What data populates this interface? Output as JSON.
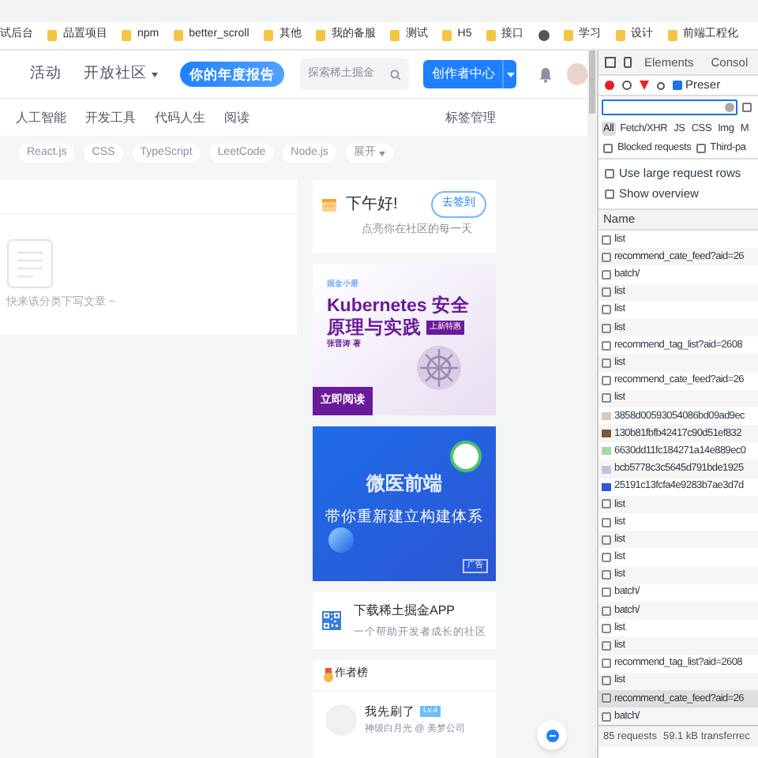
{
  "bookmarks": [
    {
      "kind": "text",
      "label": "试后台"
    },
    {
      "kind": "folder",
      "label": "品置项目"
    },
    {
      "kind": "folder",
      "label": "npm"
    },
    {
      "kind": "folder",
      "label": "better_scroll"
    },
    {
      "kind": "folder",
      "label": "其他"
    },
    {
      "kind": "folder",
      "label": "我的备服"
    },
    {
      "kind": "folder",
      "label": "测试"
    },
    {
      "kind": "folder",
      "label": "H5"
    },
    {
      "kind": "folder",
      "label": "接口"
    },
    {
      "kind": "globe"
    },
    {
      "kind": "folder",
      "label": "学习"
    },
    {
      "kind": "folder",
      "label": "设计"
    },
    {
      "kind": "folder",
      "label": "前端工程化"
    }
  ],
  "header": {
    "nav": [
      {
        "label": "活动",
        "dropdown": false
      },
      {
        "label": "开放社区",
        "dropdown": true
      }
    ],
    "year_report": "你的年度报告",
    "search": {
      "placeholder": "探索稀土掘金"
    },
    "creator_button": "创作者中心"
  },
  "categories": [
    "人工智能",
    "开发工具",
    "代码人生",
    "阅读"
  ],
  "tag_manage": "标签管理",
  "tags": [
    "React.js",
    "CSS",
    "TypeScript",
    "LeetCode",
    "Node.js"
  ],
  "expand": "展开",
  "empty_feed": {
    "message": "快来该分类下写文章 ~"
  },
  "sign_in": {
    "greeting": "下午好!",
    "button": "去签到",
    "subtitle": "点亮你在社区的每一天"
  },
  "ad_book": {
    "brand": "掘金小册",
    "title_1": "Kubernetes 安全",
    "title_2": "原理与实践",
    "badge": "上新特惠",
    "author": "张晋涛 著",
    "button": "立即阅读"
  },
  "ad_banner": {
    "title": "微医前端",
    "subtitle": "带你重新建立构建体系",
    "tag": "广告"
  },
  "app_card": {
    "title": "下载稀土掘金APP",
    "subtitle": "一个帮助开发者成长的社区"
  },
  "author_list": {
    "title": "作者榜",
    "authors": [
      {
        "name": "我先刷了",
        "level": "Lv.4",
        "description": "神级白月光 @ 美梦公司"
      }
    ]
  },
  "devtools": {
    "tabs": [
      {
        "label": "Elements",
        "selected": false
      },
      {
        "label": "Consol",
        "selected": false
      }
    ],
    "preserve_log": {
      "label": "Preser",
      "checked": true
    },
    "filters": [
      {
        "label": "All",
        "selected": true
      },
      {
        "label": "Fetch/XHR",
        "selected": false
      },
      {
        "label": "JS",
        "selected": false
      },
      {
        "label": "CSS",
        "selected": false
      },
      {
        "label": "Img",
        "selected": false
      },
      {
        "label": "M",
        "selected": false
      }
    ],
    "options": [
      {
        "label": "Blocked requests",
        "checked": false
      },
      {
        "label": "Third-pa",
        "checked": false
      }
    ],
    "more_options": [
      {
        "label": "Use large request rows",
        "checked": false
      },
      {
        "label": "Show overview",
        "checked": false
      }
    ],
    "filter_checkbox": {
      "checked": false
    },
    "column": "Name",
    "requests": [
      {
        "name": "list",
        "kind": "doc",
        "selected": false
      },
      {
        "name": "recommend_cate_feed?aid=26",
        "kind": "doc",
        "selected": false
      },
      {
        "name": "batch/",
        "kind": "doc",
        "selected": false
      },
      {
        "name": "list",
        "kind": "doc",
        "selected": false
      },
      {
        "name": "list",
        "kind": "doc",
        "selected": false
      },
      {
        "name": "list",
        "kind": "doc",
        "selected": false
      },
      {
        "name": "recommend_tag_list?aid=2608",
        "kind": "doc",
        "selected": false
      },
      {
        "name": "list",
        "kind": "doc",
        "selected": false
      },
      {
        "name": "recommend_cate_feed?aid=26",
        "kind": "doc",
        "selected": false
      },
      {
        "name": "list",
        "kind": "doc",
        "selected": false
      },
      {
        "name": "3858d00593054086bd09ad9ec",
        "kind": "image",
        "color": "#d9c9b8",
        "selected": false
      },
      {
        "name": "130b81fbfb42417c90d51ef832",
        "kind": "image",
        "color": "#7a5a3a",
        "selected": false
      },
      {
        "name": "6630dd11fc184271a14e889ec0",
        "kind": "image",
        "color": "#a8d8a0",
        "selected": false
      },
      {
        "name": "bcb5778c3c5645d791bde1925",
        "kind": "image",
        "color": "#b8c8d8",
        "selected": false
      },
      {
        "name": "25191c13fcfa4e9283b7ae3d7d",
        "kind": "image",
        "color": "#3355dd",
        "selected": false
      },
      {
        "name": "list",
        "kind": "doc",
        "selected": false
      },
      {
        "name": "list",
        "kind": "doc",
        "selected": false
      },
      {
        "name": "list",
        "kind": "doc",
        "selected": false
      },
      {
        "name": "list",
        "kind": "doc",
        "selected": false
      },
      {
        "name": "list",
        "kind": "doc",
        "selected": false
      },
      {
        "name": "batch/",
        "kind": "doc",
        "selected": false
      },
      {
        "name": "batch/",
        "kind": "doc",
        "selected": false
      },
      {
        "name": "list",
        "kind": "doc",
        "selected": false
      },
      {
        "name": "list",
        "kind": "doc",
        "selected": false
      },
      {
        "name": "recommend_tag_list?aid=2608",
        "kind": "doc",
        "selected": false
      },
      {
        "name": "list",
        "kind": "doc",
        "selected": false
      },
      {
        "name": "recommend_cate_feed?aid=26",
        "kind": "doc",
        "selected": true
      },
      {
        "name": "batch/",
        "kind": "doc",
        "selected": false
      }
    ],
    "status": [
      "85 requests",
      "59.1 kB transferrec"
    ]
  }
}
